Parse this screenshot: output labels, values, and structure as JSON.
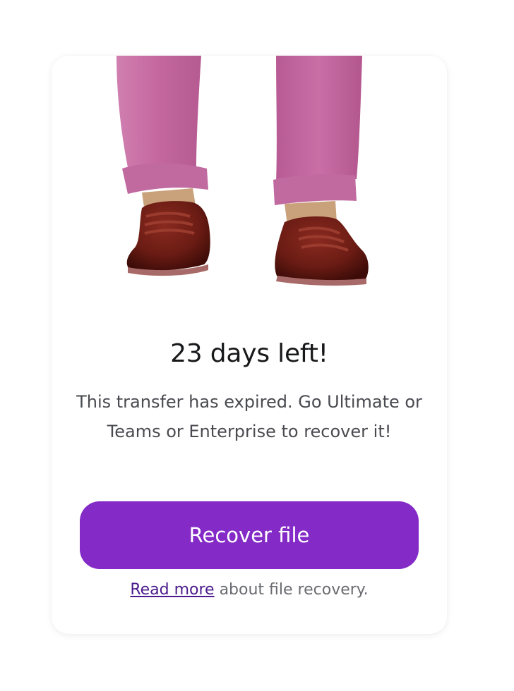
{
  "card": {
    "title": "23 days left!",
    "description": "This transfer has expired. Go Ultimate or Teams or Enterprise to recover it!",
    "recover_button_label": "Recover file",
    "footnote_link": "Read more",
    "footnote_text": " about file recovery."
  },
  "illustration": {
    "icon": "legs-with-shoes-illustration"
  },
  "colors": {
    "button_bg": "#842ac6",
    "link": "#4a1a8c",
    "title": "#17181a",
    "text": "#4a4b50",
    "pants": "#c4679f",
    "shoes": "#6b1c14"
  }
}
